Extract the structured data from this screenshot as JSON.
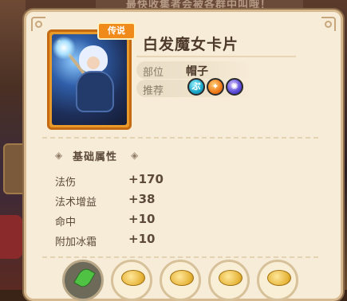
{
  "background": {
    "top_banner_text": "最快收集者会被各群中叫哦！"
  },
  "card": {
    "rarity": "传说",
    "name": "白发魔女卡片",
    "slot_label": "部位",
    "slot_value": "帽子",
    "recommend_label": "推荐",
    "recommend_icons": [
      "water-element-icon",
      "fire-element-icon",
      "arcane-element-icon"
    ]
  },
  "attributes": {
    "section_title": "基础属性",
    "stats": [
      {
        "label": "法伤",
        "value": "+170"
      },
      {
        "label": "法术增益",
        "value": "+38"
      },
      {
        "label": "命中",
        "value": "+10"
      },
      {
        "label": "附加冰霜",
        "value": "+10"
      }
    ]
  },
  "bottom_slots": [
    "leaf-item",
    "coin-item",
    "coin-item",
    "coin-item",
    "coin-item"
  ],
  "colors": {
    "panel_bg": "#f7ecd8",
    "legend_orange": "#f08a1a",
    "text_dark": "#4d3a2a"
  }
}
